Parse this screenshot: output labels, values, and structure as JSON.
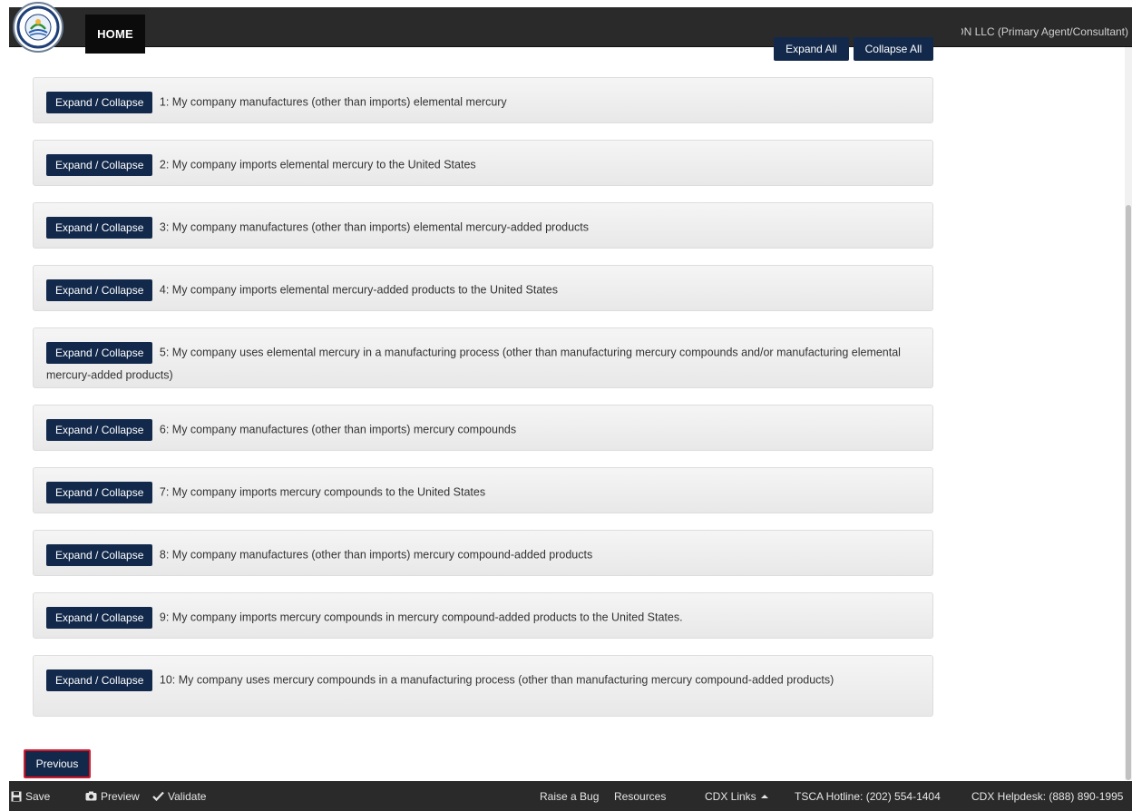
{
  "header": {
    "home_label": "HOME",
    "user_text": "Jane Doe, TEST ORGANIZATION LLC (Primary Agent/Consultant)"
  },
  "toolbar": {
    "expand_all_label": "Expand All",
    "collapse_all_label": "Collapse All"
  },
  "panels": [
    {
      "button": "Expand / Collapse",
      "text": "1: My company manufactures (other than imports) elemental mercury"
    },
    {
      "button": "Expand / Collapse",
      "text": "2: My company imports elemental mercury to the United States"
    },
    {
      "button": "Expand / Collapse",
      "text": "3: My company manufactures (other than imports) elemental mercury-added products"
    },
    {
      "button": "Expand / Collapse",
      "text": "4: My company imports elemental mercury-added products to the United States"
    },
    {
      "button": "Expand / Collapse",
      "text": "5: My company uses elemental mercury in a manufacturing process (other than manufacturing mercury compounds and/or manufacturing elemental mercury-added products)"
    },
    {
      "button": "Expand / Collapse",
      "text": "6: My company manufactures (other than imports) mercury compounds"
    },
    {
      "button": "Expand / Collapse",
      "text": "7: My company imports mercury compounds to the United States"
    },
    {
      "button": "Expand / Collapse",
      "text": "8: My company manufactures (other than imports) mercury compound-added products"
    },
    {
      "button": "Expand / Collapse",
      "text": "9: My company imports mercury compounds in mercury compound-added products to the United States."
    },
    {
      "button": "Expand / Collapse",
      "text": "10: My company uses mercury compounds in a manufacturing process (other than manufacturing mercury compound-added products)"
    }
  ],
  "navigation": {
    "previous_label": "Previous"
  },
  "footer": {
    "save_label": "Save",
    "preview_label": "Preview",
    "validate_label": "Validate",
    "raise_bug_label": "Raise a Bug",
    "resources_label": "Resources",
    "cdx_links_label": "CDX Links",
    "tsca_hotline": "TSCA Hotline: (202) 554-1404",
    "cdx_helpdesk": "CDX Helpdesk: (888) 890-1995"
  },
  "colors": {
    "navbar": "#2a2a2a",
    "button": "#13294b",
    "highlight_border": "#d8192c"
  }
}
